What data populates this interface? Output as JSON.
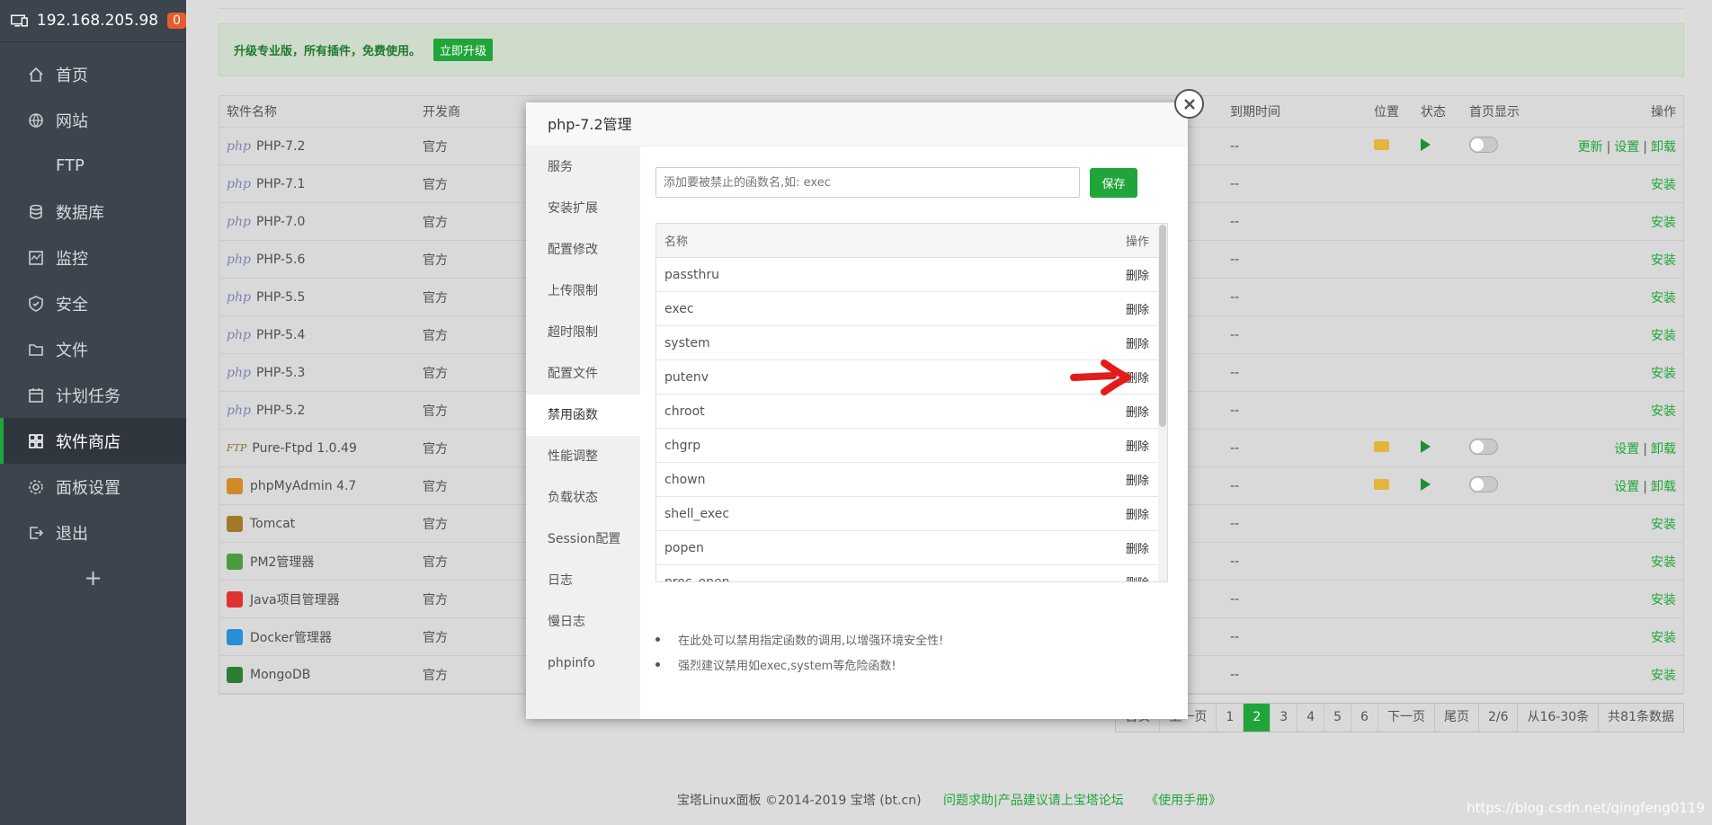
{
  "sidebar": {
    "host": "192.168.205.98",
    "badge": "0",
    "items": [
      {
        "label": "首页",
        "icon": "home-icon"
      },
      {
        "label": "网站",
        "icon": "globe-icon"
      },
      {
        "label": "FTP",
        "icon": "ftp-icon"
      },
      {
        "label": "数据库",
        "icon": "database-icon"
      },
      {
        "label": "监控",
        "icon": "monitor-icon"
      },
      {
        "label": "安全",
        "icon": "shield-icon"
      },
      {
        "label": "文件",
        "icon": "folder-icon"
      },
      {
        "label": "计划任务",
        "icon": "calendar-icon"
      },
      {
        "label": "软件商店",
        "icon": "grid-icon",
        "active": true
      },
      {
        "label": "面板设置",
        "icon": "gear-icon"
      },
      {
        "label": "退出",
        "icon": "logout-icon"
      }
    ],
    "add": "+"
  },
  "banner": {
    "text": "升级专业版，所有插件，免费使用。",
    "button": "立即升级"
  },
  "table": {
    "headers": {
      "name": "软件名称",
      "dev": "开发商",
      "expire": "到期时间",
      "location": "位置",
      "status": "状态",
      "home": "首页显示",
      "ops": "操作"
    },
    "rows": [
      {
        "name": "PHP-7.2",
        "dev": "官方",
        "expire": "--"
      },
      {
        "name": "PHP-7.1",
        "dev": "官方",
        "expire": "--",
        "op": "安装"
      },
      {
        "name": "PHP-7.0",
        "dev": "官方",
        "expire": "--",
        "op": "安装"
      },
      {
        "name": "PHP-5.6",
        "dev": "官方",
        "expire": "--",
        "op": "安装"
      },
      {
        "name": "PHP-5.5",
        "dev": "官方",
        "expire": "--",
        "op": "安装"
      },
      {
        "name": "PHP-5.4",
        "dev": "官方",
        "expire": "--",
        "op": "安装"
      },
      {
        "name": "PHP-5.3",
        "dev": "官方",
        "expire": "--",
        "op": "安装"
      },
      {
        "name": "PHP-5.2",
        "dev": "官方",
        "expire": "--",
        "op": "安装"
      },
      {
        "name": "Pure-Ftpd 1.0.49",
        "dev": "官方",
        "expire": "--"
      },
      {
        "name": "phpMyAdmin 4.7",
        "dev": "官方",
        "expire": "--"
      },
      {
        "name": "Tomcat",
        "dev": "官方",
        "expire": "--",
        "op": "安装"
      },
      {
        "name": "PM2管理器",
        "dev": "官方",
        "expire": "--",
        "op": "安装"
      },
      {
        "name": "Java项目管理器",
        "dev": "官方",
        "expire": "--",
        "op": "安装"
      },
      {
        "name": "Docker管理器",
        "dev": "官方",
        "expire": "--",
        "op": "安装"
      },
      {
        "name": "MongoDB",
        "dev": "官方",
        "expire": "--",
        "op": "安装"
      }
    ],
    "php_logo": "php",
    "ftp_logo": "FTP",
    "ops_update": "更新",
    "ops_settings": "设置",
    "ops_uninstall": "卸载",
    "ops_separator": "|"
  },
  "pager": {
    "pages": [
      "首页",
      "上一页",
      "1",
      "2",
      "3",
      "4",
      "5",
      "6",
      "下一页",
      "尾页",
      "2/6",
      "从16-30条",
      "共81条数据"
    ],
    "current": "2"
  },
  "footer": {
    "copyright": "宝塔Linux面板 ©2014-2019 宝塔 (bt.cn)",
    "help": "问题求助|产品建议请上宝塔论坛",
    "manual": "《使用手册》"
  },
  "watermark": "https://blog.csdn.net/qingfeng0119",
  "modal": {
    "title": "php-7.2管理",
    "nav": [
      "服务",
      "安装扩展",
      "配置修改",
      "上传限制",
      "超时限制",
      "配置文件",
      "禁用函数",
      "性能调整",
      "负载状态",
      "Session配置",
      "日志",
      "慢日志",
      "phpinfo"
    ],
    "active_nav": "禁用函数",
    "input_placeholder": "添加要被禁止的函数名,如: exec",
    "save": "保存",
    "col_name": "名称",
    "col_op": "操作",
    "functions": [
      "passthru",
      "exec",
      "system",
      "putenv",
      "chroot",
      "chgrp",
      "chown",
      "shell_exec",
      "popen",
      "proc_open"
    ],
    "delete": "删除",
    "tips": [
      "在此处可以禁用指定函数的调用,以增强环境安全性!",
      "强烈建议禁用如exec,system等危险函数!"
    ]
  },
  "colors": {
    "accent": "#20a53a",
    "sidebar": "#3c444d",
    "arrow": "#e41b1b"
  }
}
